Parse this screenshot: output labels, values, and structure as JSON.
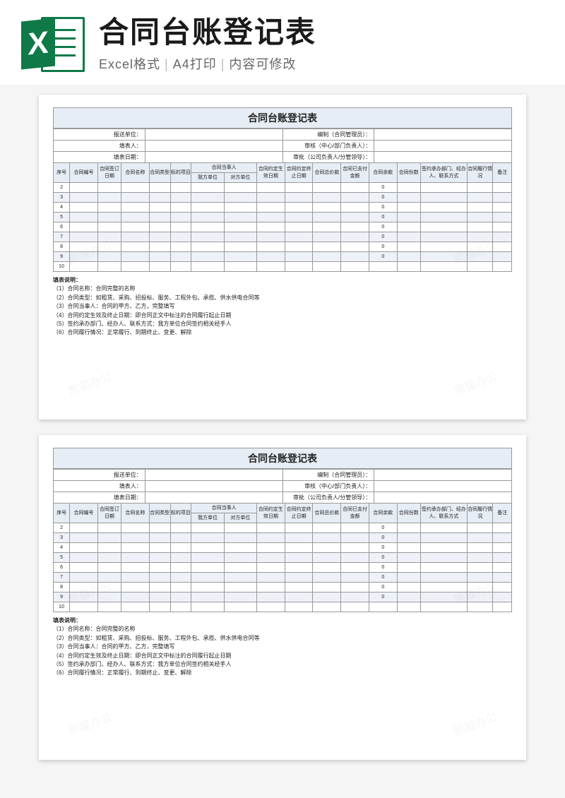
{
  "banner": {
    "title": "合同台账登记表",
    "sub_format": "Excel格式",
    "sub_print": "A4打印",
    "sub_edit": "内容可修改"
  },
  "excel_icon": {
    "letter": "X"
  },
  "doc": {
    "title": "合同台账登记表",
    "meta_left": [
      {
        "label": "报送单位：",
        "value": ""
      },
      {
        "label": "填表人：",
        "value": ""
      },
      {
        "label": "填表日期：",
        "value": ""
      }
    ],
    "meta_right": [
      {
        "label": "编制（合同管理员）：",
        "value": ""
      },
      {
        "label": "审核（中心/部门负责人）：",
        "value": ""
      },
      {
        "label": "审批（公司负责人/分管领导）：",
        "value": ""
      }
    ],
    "headers_top": [
      "序号",
      "合同编号",
      "合同签订日期",
      "合同名称",
      "合同类型",
      "标的项目",
      "合同当事人",
      "合同约定生效日期",
      "合同约定终止日期",
      "合同总价款",
      "合同已支付金额",
      "合同余款",
      "合同份数",
      "签约承办部门、经办人、联系方式",
      "合同履行情况",
      "备注"
    ],
    "party_sub": {
      "ours": "我方单位",
      "theirs": "对方单位"
    },
    "rows": [
      {
        "seq": "2",
        "balance": "0"
      },
      {
        "seq": "3",
        "balance": "0"
      },
      {
        "seq": "4",
        "balance": "0"
      },
      {
        "seq": "5",
        "balance": "0"
      },
      {
        "seq": "6",
        "balance": "0"
      },
      {
        "seq": "7",
        "balance": "0"
      },
      {
        "seq": "8",
        "balance": "0"
      },
      {
        "seq": "9",
        "balance": "0"
      },
      {
        "seq": "10",
        "balance": ""
      }
    ],
    "notes_title": "填表说明：",
    "notes": [
      "（1）合同名称：合同完整的名称",
      "（2）合同类型：如租赁、采购、招投标、服务、工程外包、承揽、供水供电合同等",
      "（3）合同当事人：合同的甲方、乙方，完整填写",
      "（4）合同约定生效及终止日期：即合同正文中标注的合同履行起止日期",
      "（5）签约承办部门、经办人、联系方式：我方单位合同签约相关经手人",
      "（6）合同履行情况：正常履行、到期终止、变更、解除"
    ]
  },
  "watermark": "熊猫办公"
}
